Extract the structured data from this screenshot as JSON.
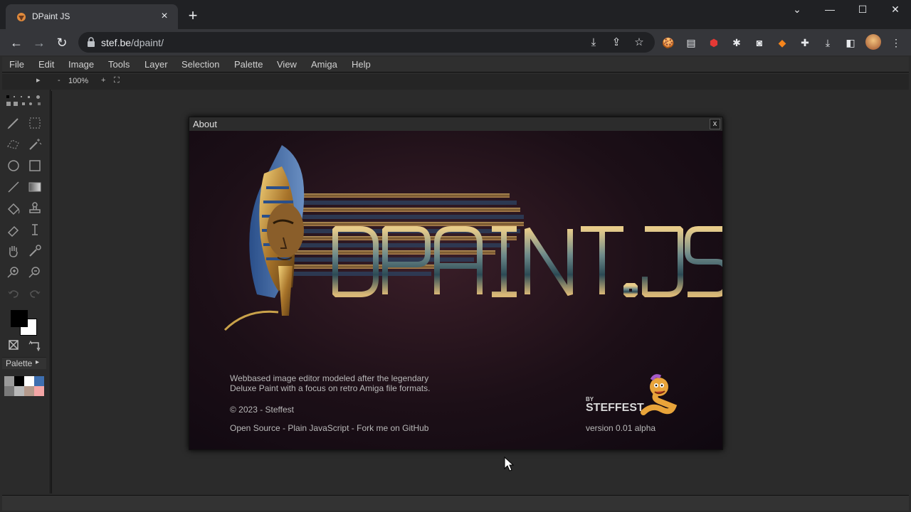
{
  "browser": {
    "tab_title": "DPaint JS",
    "url_host": "stef.be",
    "url_path": "/dpaint/"
  },
  "menu": {
    "items": [
      "File",
      "Edit",
      "Image",
      "Tools",
      "Layer",
      "Selection",
      "Palette",
      "View",
      "Amiga",
      "Help"
    ]
  },
  "zoom": {
    "minus": "-",
    "value": "100%",
    "plus": "+"
  },
  "panel": {
    "palette_label": "Palette",
    "palette_colors": [
      "#9a9a9a",
      "#000000",
      "#ffffff",
      "#3e6fb0",
      "#7a7a7a",
      "#b8b8b8",
      "#b49a8c",
      "#f4a6a6"
    ],
    "fg_color": "#000000",
    "bg_color": "#ffffff"
  },
  "about": {
    "title": "About",
    "close": "x",
    "logo_text": "DPAINT.JS",
    "description_line1": "Webbased image editor modeled after the legendary",
    "description_line2": "Deluxe Paint with a focus on retro Amiga file formats.",
    "copyright": "© 2023 - Steffest",
    "link_open_source": "Open Source",
    "link_sep1": " - ",
    "link_plain_js": "Plain JavaScript",
    "link_sep2": " - ",
    "link_github": "Fork me on GitHub",
    "by": "BY",
    "author_logo": "STEFFEST",
    "version": "version 0.01 alpha"
  }
}
